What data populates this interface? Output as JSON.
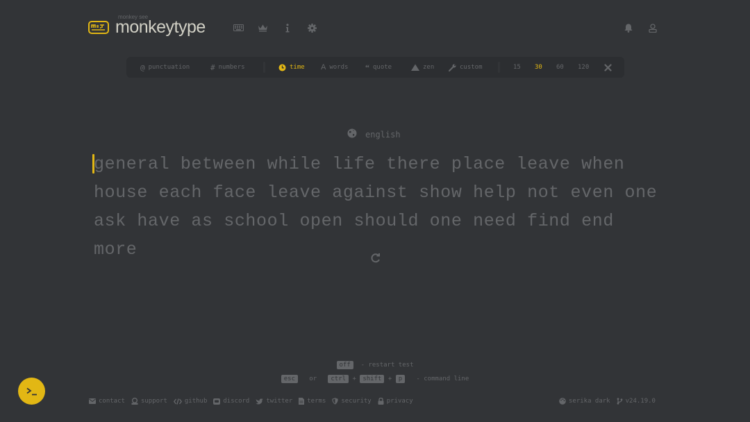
{
  "header": {
    "logo_subtitle": "monkey see",
    "logo_text": "monkeytype",
    "nav_icons": [
      "keyboard-icon",
      "crown-icon",
      "info-icon",
      "gear-icon"
    ],
    "right_icons": [
      "bell-icon",
      "user-icon"
    ]
  },
  "config": {
    "modifiers": [
      {
        "label": "punctuation",
        "icon": "at-icon",
        "active": false
      },
      {
        "label": "numbers",
        "icon": "hash-icon",
        "active": false
      }
    ],
    "modes": [
      {
        "label": "time",
        "icon": "clock-icon",
        "active": true
      },
      {
        "label": "words",
        "icon": "font-icon",
        "active": false
      },
      {
        "label": "quote",
        "icon": "quote-icon",
        "active": false
      },
      {
        "label": "zen",
        "icon": "mountain-icon",
        "active": false
      },
      {
        "label": "custom",
        "icon": "wrench-icon",
        "active": false
      }
    ],
    "durations": [
      {
        "label": "15",
        "active": false
      },
      {
        "label": "30",
        "active": true
      },
      {
        "label": "60",
        "active": false
      },
      {
        "label": "120",
        "active": false
      }
    ],
    "custom_duration_icon": "tools-icon"
  },
  "test": {
    "language": "english",
    "lines": [
      "general between while life there place leave when",
      "house each face leave against show help not even one",
      "ask have as school open should one need find end more"
    ]
  },
  "hints": {
    "restart_key": "off",
    "restart_text": "- restart test",
    "cmd_key1": "esc",
    "or_text": "or",
    "cmd_key2": "ctrl",
    "plus1": "+",
    "cmd_key3": "shift",
    "plus2": "+",
    "cmd_key4": "p",
    "cmd_text": "- command line"
  },
  "footer": {
    "links": [
      {
        "label": "contact",
        "icon": "envelope-icon"
      },
      {
        "label": "support",
        "icon": "donate-icon"
      },
      {
        "label": "github",
        "icon": "code-icon"
      },
      {
        "label": "discord",
        "icon": "discord-icon"
      },
      {
        "label": "twitter",
        "icon": "twitter-icon"
      },
      {
        "label": "terms",
        "icon": "file-icon"
      },
      {
        "label": "security",
        "icon": "shield-icon"
      },
      {
        "label": "privacy",
        "icon": "lock-icon"
      }
    ],
    "theme": "serika dark",
    "version": "v24.19.0"
  },
  "colors": {
    "background": "#323437",
    "sub_background": "#2c2e31",
    "main": "#e2b714",
    "sub": "#646669",
    "text": "#d1d0c5"
  }
}
